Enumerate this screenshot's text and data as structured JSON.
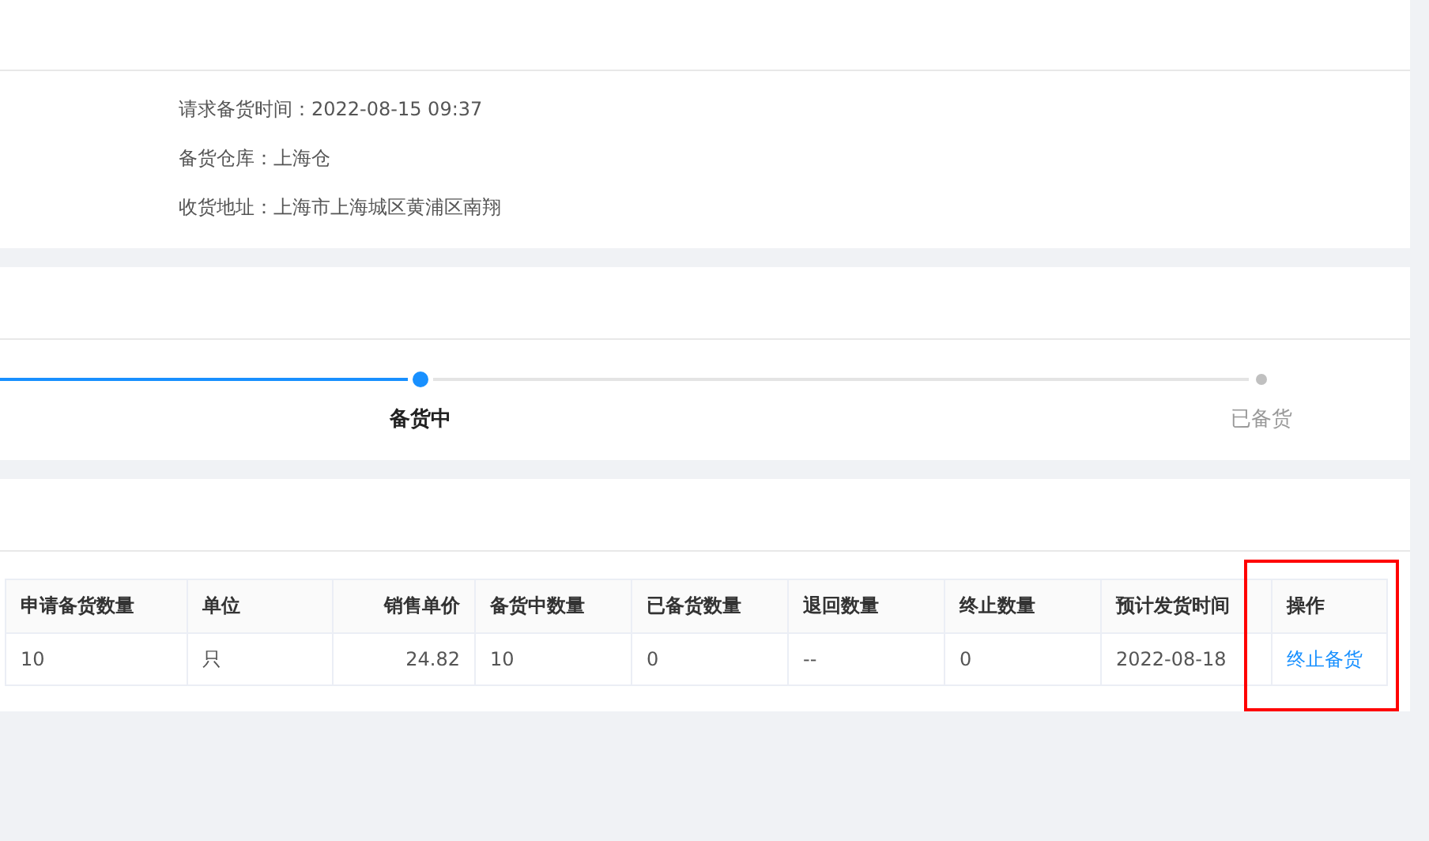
{
  "info": [
    {
      "label": "请求备货时间：",
      "value": "2022-08-15 09:37"
    },
    {
      "label": "备货仓库：",
      "value": "上海仓"
    },
    {
      "label": "收货地址：",
      "value": "上海市上海城区黄浦区南翔"
    }
  ],
  "steps": [
    {
      "label": "备货中",
      "current": true
    },
    {
      "label": "已备货",
      "current": false
    }
  ],
  "table": {
    "columns": [
      {
        "label": "申请备货数量",
        "kind": "text",
        "highlighted": false
      },
      {
        "label": "单位",
        "kind": "text",
        "highlighted": false
      },
      {
        "label": "销售单价",
        "kind": "price",
        "highlighted": false
      },
      {
        "label": "备货中数量",
        "kind": "text",
        "highlighted": false
      },
      {
        "label": "已备货数量",
        "kind": "text",
        "highlighted": false
      },
      {
        "label": "退回数量",
        "kind": "text",
        "highlighted": false
      },
      {
        "label": "终止数量",
        "kind": "text",
        "highlighted": false
      },
      {
        "label": "预计发货时间",
        "kind": "text",
        "highlighted": false
      },
      {
        "label": "操作",
        "kind": "text",
        "highlighted": true
      }
    ],
    "rows": [
      {
        "cells": [
          {
            "text": "10",
            "kind": "text"
          },
          {
            "text": "只",
            "kind": "text"
          },
          {
            "text": "24.82",
            "kind": "text"
          },
          {
            "text": "10",
            "kind": "text"
          },
          {
            "text": "0",
            "kind": "text"
          },
          {
            "text": "--",
            "kind": "text"
          },
          {
            "text": "0",
            "kind": "text"
          },
          {
            "text": "2022-08-18",
            "kind": "text"
          },
          {
            "text": "终止备货",
            "kind": "link"
          }
        ]
      }
    ]
  }
}
